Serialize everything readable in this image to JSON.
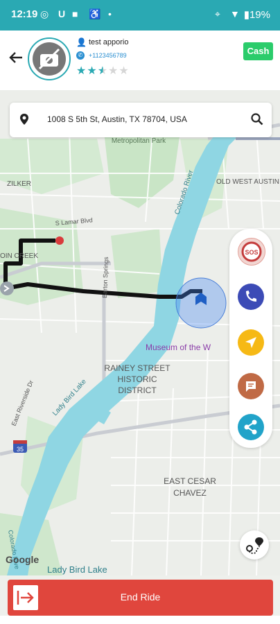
{
  "status_bar": {
    "time": "12:19",
    "battery": "19%"
  },
  "header": {
    "rider_name": "test apporio",
    "rider_phone": "+1123456789",
    "rating": 2.5,
    "payment_label": "Cash"
  },
  "search": {
    "address": "1008 S 5th St, Austin, TX 78704, USA"
  },
  "map": {
    "labels": {
      "metropolitan_park": "Metropolitan Park",
      "zilker": "ZILKER",
      "old_west_austin": "OLD WEST AUSTIN",
      "colorado_river": "Colorado River",
      "s_lamar": "S Lamar Blvd",
      "barton_springs": "Barton Springs",
      "oin_creek": "OIN CREEK",
      "museum": "Museum of the W",
      "rainey_street": "RAINEY STREET",
      "historic": "HISTORIC",
      "district": "DISTRICT",
      "lady_bird_lake": "Lady Bird Lake",
      "east_riverside": "East Riverside Dr",
      "east_cesar": "EAST CESAR",
      "chavez": "CHAVEZ",
      "colorado_river_bottom": "Colorado Rive",
      "lady_bird_lake_bottom": "Lady Bird Lake",
      "google": "Google",
      "route_35": "35"
    }
  },
  "side_actions": [
    "sos-button",
    "call-button",
    "navigate-button",
    "chat-button",
    "share-button"
  ],
  "colors": {
    "primary": "#2aa9b3",
    "end_ride": "#e0463d",
    "cash": "#2bcc6b",
    "call": "#3c4bb6",
    "navigate": "#f6b915",
    "chat": "#c06a45",
    "share": "#21a3c9"
  },
  "end_ride": {
    "label": "End Ride"
  }
}
